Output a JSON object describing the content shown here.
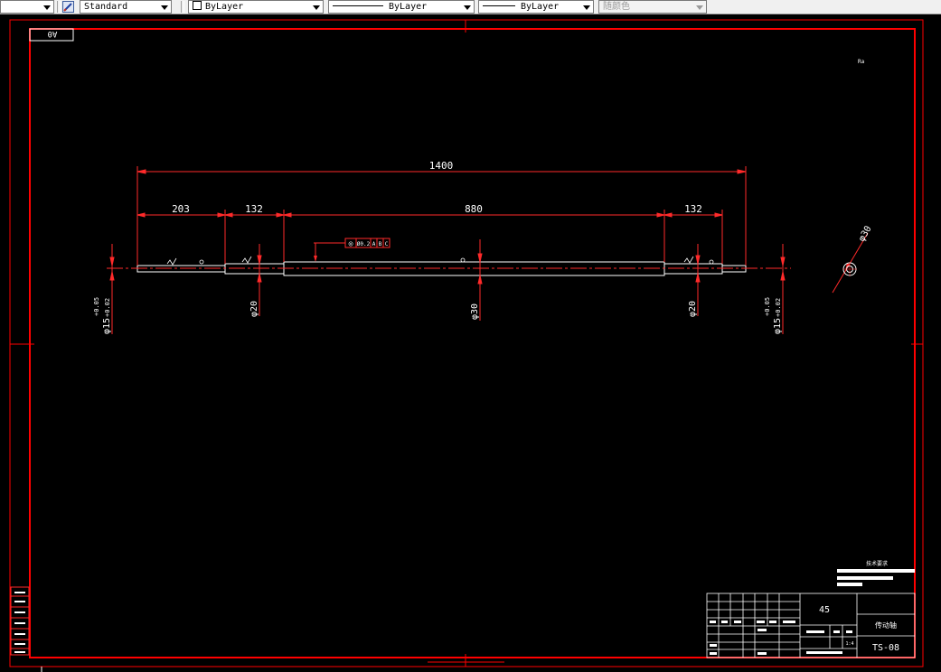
{
  "toolbar": {
    "first_combo": "",
    "text_style": "Standard",
    "layer_color": "ByLayer",
    "linetype": "ByLayer",
    "lineweight": "ByLayer",
    "plot_style": "随颜色"
  },
  "drawing": {
    "sheet_size": "A0",
    "roughness_note": "Ra",
    "dims": {
      "overall": "1400",
      "seg1": "203",
      "seg2": "132",
      "seg3": "880",
      "seg4": "132",
      "dia_left_end": "φ15",
      "tol_upper": "+0.05",
      "tol_lower": "+0.02",
      "dia_20_left": "φ20",
      "dia_30": "φ30",
      "dia_20_right": "φ20",
      "dia_right_end": "φ15",
      "dia_section": "φ30"
    },
    "gdt": {
      "symbol": "◎",
      "tolerance": "Ø0.2",
      "datum_a": "A",
      "datum_b": "B",
      "datum_c": "C"
    },
    "tech_req_title": "技术要求",
    "title_block": {
      "material": "45",
      "part_name": "传动轴",
      "drawing_no": "TS-08",
      "scale": "1:4"
    }
  },
  "colors": {
    "frame": "#ff0000",
    "geometry": "#ffffff",
    "dimension": "#ff2a2a",
    "background": "#000000"
  }
}
